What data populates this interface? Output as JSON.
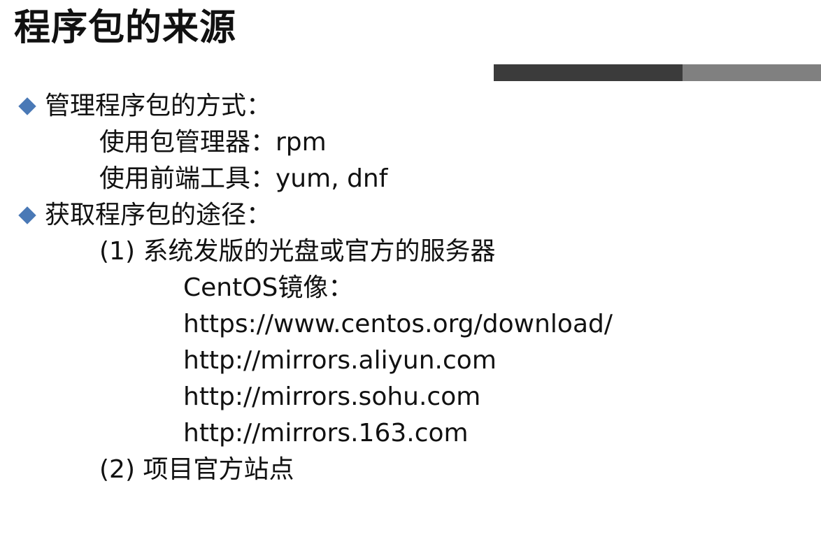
{
  "slide": {
    "title": "程序包的来源",
    "colors": {
      "accent_dark": "#3b3b3b",
      "accent_light": "#808080",
      "bullet": "#4a79b6"
    },
    "sections": [
      {
        "heading": "管理程序包的方式：",
        "icon": "diamond-bullet-icon",
        "items": [
          "使用包管理器：rpm",
          "使用前端工具：yum, dnf"
        ]
      },
      {
        "heading": "获取程序包的途径：",
        "icon": "diamond-bullet-icon",
        "items": [
          "(1) 系统发版的光盘或官方的服务器",
          "CentOS镜像：",
          "https://www.centos.org/download/",
          "http://mirrors.aliyun.com",
          "http://mirrors.sohu.com",
          "http://mirrors.163.com",
          "(2) 项目官方站点"
        ]
      }
    ]
  }
}
